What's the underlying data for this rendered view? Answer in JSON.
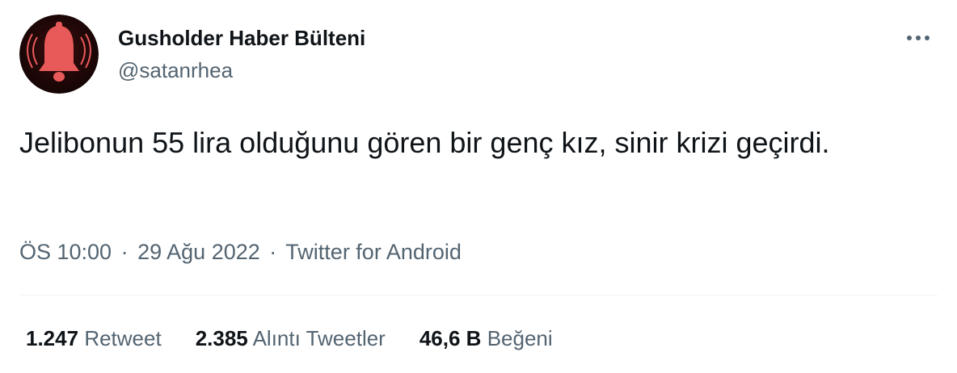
{
  "author": {
    "display_name": "Gusholder Haber Bülteni",
    "handle": "@satanrhea",
    "avatar_icon": "bell-icon",
    "avatar_colors": {
      "background": "#1a0606",
      "bell": "#e85a5a"
    }
  },
  "more_icon": "more-icon",
  "tweet": {
    "text": "Jelibonun 55 lira olduğunu gören bir genç kız, sinir krizi geçirdi.",
    "time": "ÖS 10:00",
    "date": "29 Ağu 2022",
    "source": "Twitter for Android",
    "separator": "·"
  },
  "stats": {
    "retweets": {
      "count": "1.247",
      "label": "Retweet"
    },
    "quotes": {
      "count": "2.385",
      "label": "Alıntı Tweetler"
    },
    "likes": {
      "count": "46,6 B",
      "label": "Beğeni"
    }
  }
}
